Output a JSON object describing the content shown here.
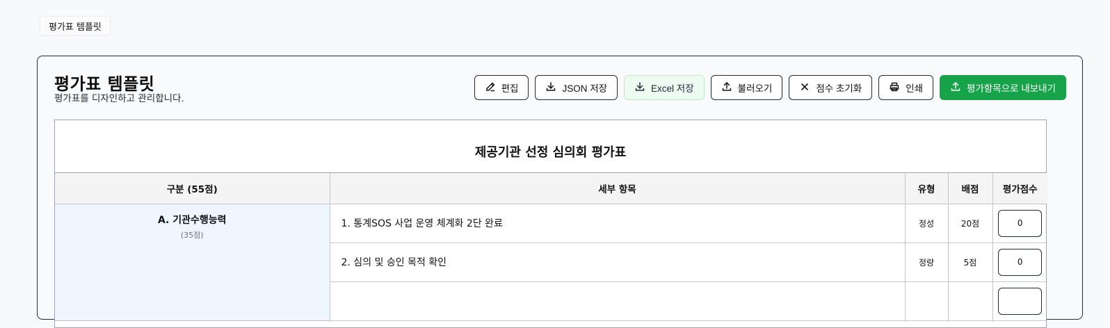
{
  "tab": {
    "label": "평가표 템플릿"
  },
  "header": {
    "title": "평가표 템플릿",
    "subtitle": "평가표를 디자인하고 관리합니다."
  },
  "toolbar": {
    "edit": "편집",
    "save_json": "JSON 저장",
    "save_excel": "Excel 저장",
    "load": "불러오기",
    "reset_scores": "점수 초기화",
    "print": "인쇄",
    "export_items": "평가항목으로 내보내기"
  },
  "sheet": {
    "title": "제공기관 선정 심의회 평가표",
    "columns": {
      "category": "구분 (55점)",
      "detail": "세부 항목",
      "type": "유형",
      "points": "배점",
      "score": "평가점수"
    },
    "section": {
      "name": "A. 기관수행능력",
      "points": "(35점)"
    },
    "rows": [
      {
        "item": "1. 통계SOS 사업 운영 체계화 2단 완료",
        "type": "정성",
        "points": "20점",
        "score": "0"
      },
      {
        "item": "2. 심의 및 승인 목적 확인",
        "type": "정량",
        "points": "5점",
        "score": "0"
      },
      {
        "item": "",
        "type": "",
        "points": "",
        "score": ""
      }
    ]
  },
  "colors": {
    "primary": "#16a34a",
    "section_bg": "#eef6ff",
    "border": "#1f2937"
  }
}
